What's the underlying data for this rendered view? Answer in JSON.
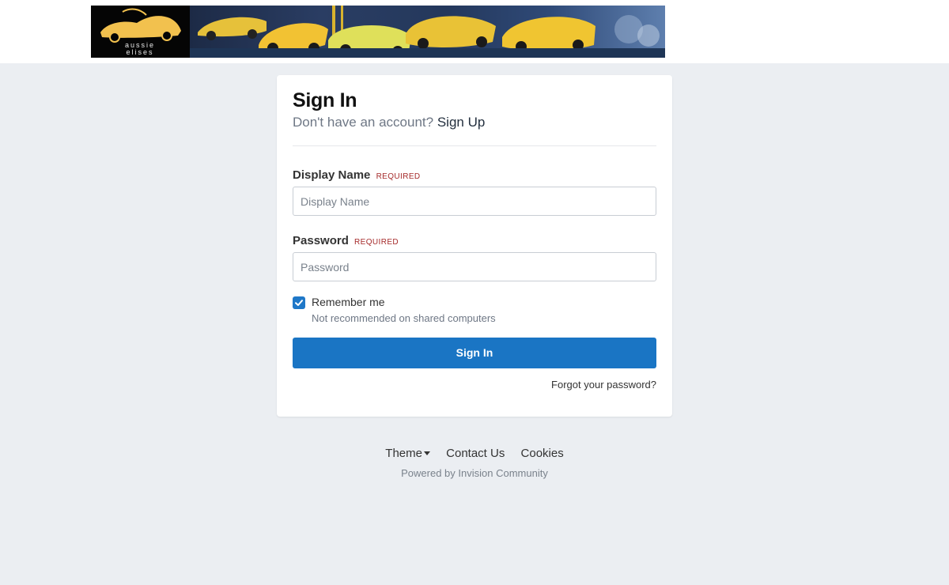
{
  "banner": {
    "logo_line1": "aussie",
    "logo_line2": "elises"
  },
  "signin": {
    "title": "Sign In",
    "subtitle_prefix": "Don't have an account?",
    "signup_link": "Sign Up",
    "display_name_label": "Display Name",
    "display_name_required": "REQUIRED",
    "display_name_placeholder": "Display Name",
    "password_label": "Password",
    "password_required": "REQUIRED",
    "password_placeholder": "Password",
    "remember_label": "Remember me",
    "remember_checked": true,
    "remember_desc": "Not recommended on shared computers",
    "submit_label": "Sign In",
    "forgot_link": "Forgot your password?"
  },
  "footer": {
    "theme_label": "Theme",
    "contact_label": "Contact Us",
    "cookies_label": "Cookies",
    "powered_by": "Powered by Invision Community"
  },
  "colors": {
    "page_bg": "#ebeef2",
    "accent": "#1a75c4",
    "required": "#a52a2a"
  }
}
